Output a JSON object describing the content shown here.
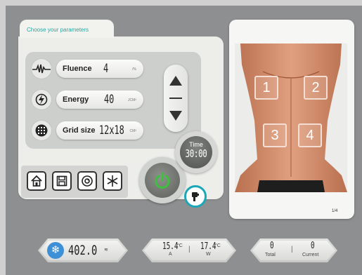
{
  "panel": {
    "tab_title": "Choose your parameters"
  },
  "params": [
    {
      "label": "Fluence",
      "value": "4",
      "unit": "/%",
      "icon": "pulse-wave-icon"
    },
    {
      "label": "Energy",
      "value": "40",
      "unit": "JCM²",
      "icon": "energy-bolt-icon"
    },
    {
      "label": "Grid size",
      "value": "12x18",
      "unit": "CM²",
      "icon": "grid-dots-icon"
    }
  ],
  "stepper": {
    "up_icon": "triangle-up-icon",
    "down_icon": "triangle-down-icon"
  },
  "nav_buttons": [
    {
      "name": "home-button",
      "icon": "home-icon"
    },
    {
      "name": "save-button",
      "icon": "floppy-disk-icon"
    },
    {
      "name": "settings-button",
      "icon": "settings-circle-icon"
    },
    {
      "name": "cooling-button",
      "icon": "snowflake-icon"
    }
  ],
  "power": {
    "icon": "power-icon",
    "color": "#3fbf3f"
  },
  "time": {
    "label": "Time",
    "value": "30:00"
  },
  "handpiece": {
    "icon": "handpiece-icon",
    "color": "#1aa7b7"
  },
  "body_image": {
    "zones": [
      "1",
      "2",
      "3",
      "4"
    ],
    "page_counter": "1/4"
  },
  "status": {
    "cooling_value": "402.0",
    "temperature_a": "15.4",
    "temperature_a_unit": "°C",
    "temperature_a_label": "A",
    "temperature_w": "17.4",
    "temperature_w_unit": "°C",
    "temperature_w_label": "W",
    "total_value": "0",
    "total_label": "Total",
    "current_value": "0",
    "current_label": "Current"
  },
  "colors": {
    "accent": "#2aa6a0",
    "cooling_blue": "#3d8fd6",
    "power_green": "#3fbf3f"
  }
}
